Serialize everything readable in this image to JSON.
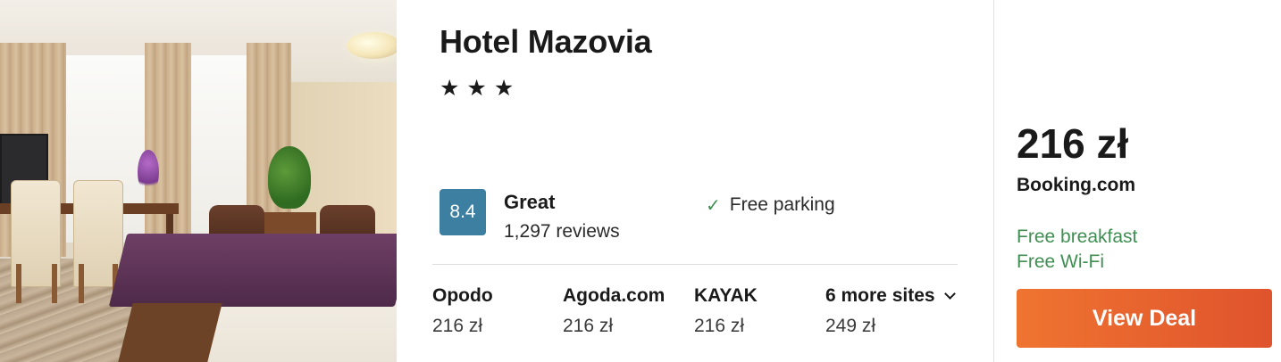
{
  "hotel": {
    "name": "Hotel Mazovia",
    "stars": [
      "★",
      "★",
      "★"
    ],
    "rating_score": "8.4",
    "rating_label": "Great",
    "reviews": "1,297 reviews",
    "amenity": "Free parking",
    "check_glyph": "✓",
    "rating_color": "#3c7fa1"
  },
  "providers": [
    {
      "name": "Opodo",
      "price": "216 zł"
    },
    {
      "name": "Agoda.com",
      "price": "216 zł"
    },
    {
      "name": "KAYAK",
      "price": "216 zł"
    },
    {
      "name": "6 more sites",
      "price": "249 zł"
    }
  ],
  "deal": {
    "price": "216 zł",
    "provider": "Booking.com",
    "perks": [
      "Free breakfast",
      "Free Wi-Fi"
    ],
    "button_label": "View Deal",
    "button_color": "#e8642f",
    "perk_color": "#3f8f52"
  }
}
